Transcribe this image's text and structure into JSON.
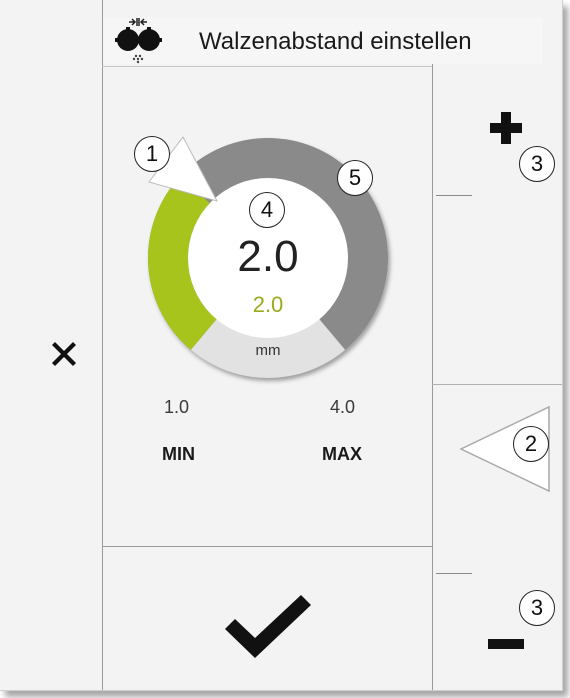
{
  "header": {
    "title": "Walzenabstand einstellen",
    "icon": "roller-gap-icon"
  },
  "dial": {
    "current_value": "2.0",
    "target_value": "2.0",
    "unit": "mm",
    "min_value": "1.0",
    "max_value": "4.0",
    "min_label": "MIN",
    "max_label": "MAX",
    "level_fraction": 0.333,
    "colors": {
      "active": "#a7c41c",
      "inactive": "#8a8a8a",
      "unit_band": "#e2e2e2",
      "target_text": "#9aaa1a"
    }
  },
  "callouts": {
    "c1": "1",
    "c2": "2",
    "c3_top": "3",
    "c3_bottom": "3",
    "c4": "4",
    "c5": "5"
  },
  "buttons": {
    "close": "close-icon",
    "confirm": "checkmark-icon",
    "increase": "plus-icon",
    "decrease": "minus-icon",
    "pointer": "triangle-pointer-icon"
  }
}
